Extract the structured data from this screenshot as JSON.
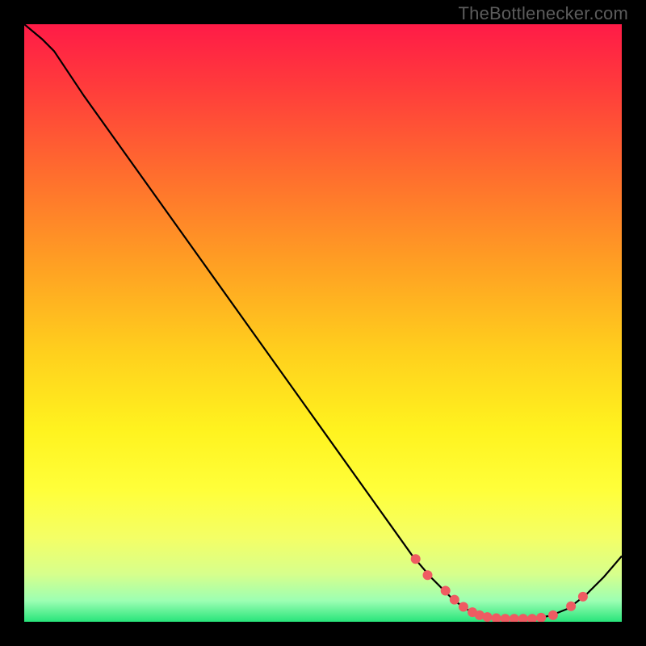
{
  "watermark": "TheBottlenecker.com",
  "chart_data": {
    "type": "line",
    "title": "",
    "xlabel": "",
    "ylabel": "",
    "xlim": [
      0,
      100
    ],
    "ylim": [
      0,
      100
    ],
    "background_gradient": {
      "stops": [
        {
          "offset": 0.0,
          "color": "#ff1b47"
        },
        {
          "offset": 0.1,
          "color": "#ff3a3c"
        },
        {
          "offset": 0.25,
          "color": "#ff6d2e"
        },
        {
          "offset": 0.4,
          "color": "#ff9f23"
        },
        {
          "offset": 0.55,
          "color": "#ffd01d"
        },
        {
          "offset": 0.68,
          "color": "#fff31f"
        },
        {
          "offset": 0.78,
          "color": "#ffff3a"
        },
        {
          "offset": 0.86,
          "color": "#f4ff66"
        },
        {
          "offset": 0.92,
          "color": "#d7ff8c"
        },
        {
          "offset": 0.965,
          "color": "#9cffb3"
        },
        {
          "offset": 1.0,
          "color": "#28e47a"
        }
      ]
    },
    "series": [
      {
        "name": "bottleneck-curve",
        "stroke": "#000000",
        "x": [
          0,
          3,
          5,
          10,
          20,
          30,
          40,
          50,
          60,
          65,
          68,
          70,
          72,
          75,
          78,
          82,
          85,
          88,
          91,
          94,
          97,
          100
        ],
        "y": [
          100,
          97.5,
          95.5,
          88,
          74,
          60,
          46,
          32,
          18,
          11,
          7.5,
          5.5,
          3.5,
          1.5,
          0.8,
          0.5,
          0.5,
          1.0,
          2.2,
          4.5,
          7.5,
          11
        ]
      }
    ],
    "markers": {
      "name": "highlight-points",
      "color": "#ef5b62",
      "radius": 6,
      "x": [
        65.5,
        67.5,
        70.5,
        72,
        73.5,
        75,
        76.2,
        77.5,
        79,
        80.5,
        82,
        83.5,
        85,
        86.5,
        88.5,
        91.5,
        93.5
      ],
      "y": [
        10.5,
        7.8,
        5.2,
        3.7,
        2.5,
        1.6,
        1.1,
        0.8,
        0.6,
        0.5,
        0.5,
        0.5,
        0.5,
        0.7,
        1.1,
        2.6,
        4.2
      ]
    }
  }
}
